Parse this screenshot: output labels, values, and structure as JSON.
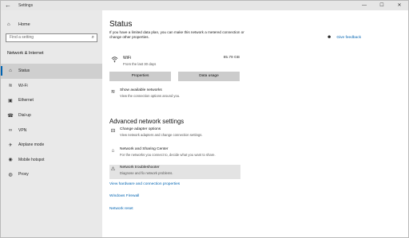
{
  "window": {
    "title": "Settings",
    "back_glyph": "←",
    "controls": {
      "minimize": "—",
      "maximize": "☐",
      "close": "✕"
    }
  },
  "sidebar": {
    "home_label": "Home",
    "search_placeholder": "Find a setting",
    "section_title": "Network & Internet",
    "items": [
      {
        "label": "Status",
        "icon": "home-icon",
        "glyph": "⌂",
        "active": true
      },
      {
        "label": "Wi-Fi",
        "icon": "wifi-icon",
        "glyph": "≋"
      },
      {
        "label": "Ethernet",
        "icon": "ethernet-icon",
        "glyph": "▣"
      },
      {
        "label": "Dial-up",
        "icon": "dialup-icon",
        "glyph": "☎"
      },
      {
        "label": "VPN",
        "icon": "vpn-icon",
        "glyph": "∞"
      },
      {
        "label": "Airplane mode",
        "icon": "airplane-icon",
        "glyph": "✈"
      },
      {
        "label": "Mobile hotspot",
        "icon": "hotspot-icon",
        "glyph": "◉"
      },
      {
        "label": "Proxy",
        "icon": "globe-icon",
        "glyph": "◍"
      }
    ]
  },
  "main": {
    "title": "Status",
    "intro": "If you have a limited data plan, you can make this network a metered connection or change other properties.",
    "feedback_label": "Give feedback",
    "network": {
      "name": "WiFi",
      "period": "From the last 30 days",
      "usage": "85.79 GB"
    },
    "buttons": {
      "properties": "Properties",
      "data_usage": "Data usage"
    },
    "show_networks": {
      "title": "Show available networks",
      "desc": "View the connection options around you."
    },
    "advanced_title": "Advanced network settings",
    "advanced_items": [
      {
        "title": "Change adapter options",
        "desc": "View network adapters and change connection settings.",
        "icon": "adapter-icon",
        "glyph": "⊟"
      },
      {
        "title": "Network and Sharing Center",
        "desc": "For the networks you connect to, decide what you want to share.",
        "icon": "sharing-icon",
        "glyph": "⌂"
      },
      {
        "title": "Network troubleshooter",
        "desc": "Diagnose and fix network problems.",
        "icon": "warning-icon",
        "glyph": "⚠",
        "highlighted": true
      }
    ],
    "links": {
      "hardware": "View hardware and connection properties",
      "firewall": "Windows Firewall",
      "reset": "Network reset"
    }
  },
  "colors": {
    "accent": "#0063b1",
    "sidebar_bg": "#e9e9e9",
    "button_bg": "#cccccc"
  }
}
